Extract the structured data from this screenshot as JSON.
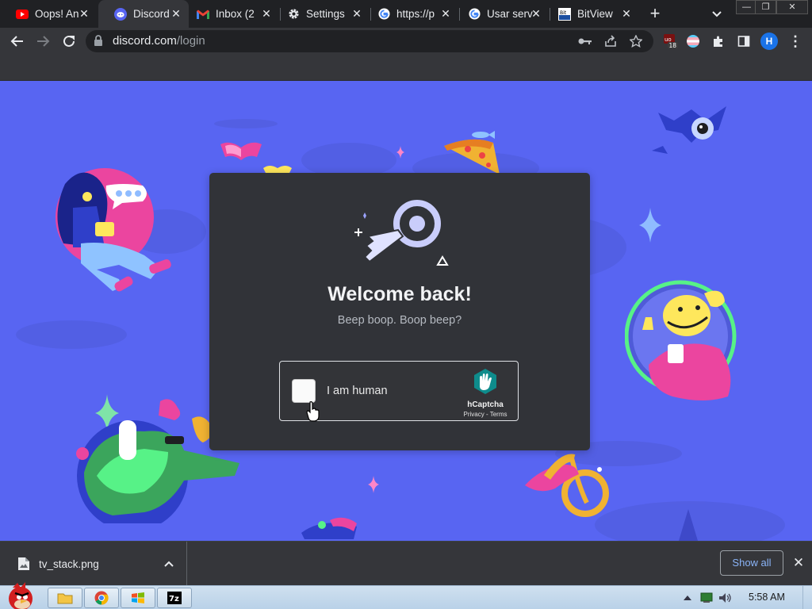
{
  "tabs": [
    {
      "title": "Oops! An",
      "icon": "youtube-icon",
      "active": false
    },
    {
      "title": "Discord",
      "icon": "discord-icon",
      "active": true
    },
    {
      "title": "Inbox (2",
      "icon": "gmail-icon",
      "active": false
    },
    {
      "title": "Settings",
      "icon": "gear-icon",
      "active": false
    },
    {
      "title": "https://p",
      "icon": "google-icon",
      "active": false
    },
    {
      "title": "Usar serv",
      "icon": "google-icon",
      "active": false
    },
    {
      "title": "BitView",
      "icon": "bitview-icon",
      "active": false
    }
  ],
  "toolbar": {
    "url_host": "discord.com",
    "url_path": "/login",
    "extension_badge": "18",
    "profile_initial": "H"
  },
  "login": {
    "heading": "Welcome back!",
    "subheading": "Beep boop. Boop beep?",
    "captcha_label": "I am human",
    "captcha_brand": "hCaptcha",
    "captcha_links": "Privacy - Terms"
  },
  "downloads": {
    "filename": "tv_stack.png",
    "show_all": "Show all"
  },
  "taskbar": {
    "clock": "5:58 AM"
  },
  "colors": {
    "discord_blurple": "#5865f2",
    "card_bg": "#313338",
    "chrome_dark": "#202124",
    "chrome_toolbar": "#35363a",
    "link_blue": "#8ab4f8"
  }
}
